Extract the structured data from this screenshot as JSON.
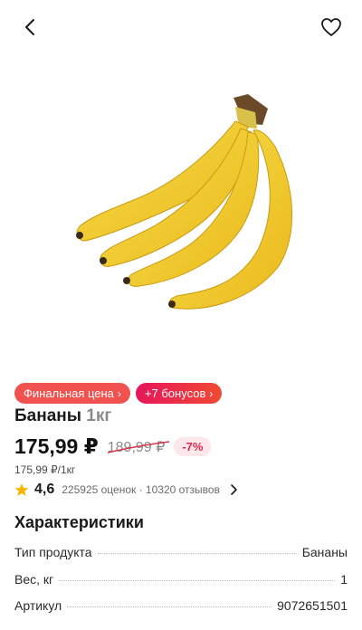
{
  "header": {
    "back_icon": "chevron-left-icon",
    "favorite_icon": "heart-icon"
  },
  "product": {
    "name": "Бананы",
    "weight": "1кг",
    "image": "bananas-photo"
  },
  "badges": {
    "final_price": "Финальная цена",
    "bonus": "+7 бонусов"
  },
  "price": {
    "current": "175,99 ₽",
    "old": "189,99 ₽",
    "discount": "-7%",
    "unit": "175,99 ₽/1кг"
  },
  "rating": {
    "value": "4,6",
    "meta": "225925 оценок · 10320 отзывов"
  },
  "characteristics": {
    "title": "Характеристики",
    "rows": [
      {
        "label": "Тип продукта",
        "value": "Бананы"
      },
      {
        "label": "Вес, кг",
        "value": "1"
      },
      {
        "label": "Артикул",
        "value": "9072651501"
      }
    ]
  },
  "colors": {
    "accent_red": "#f0524f",
    "bonus_gradient": "#e6155c",
    "discount_text": "#e0284f",
    "star": "#f5b400"
  }
}
